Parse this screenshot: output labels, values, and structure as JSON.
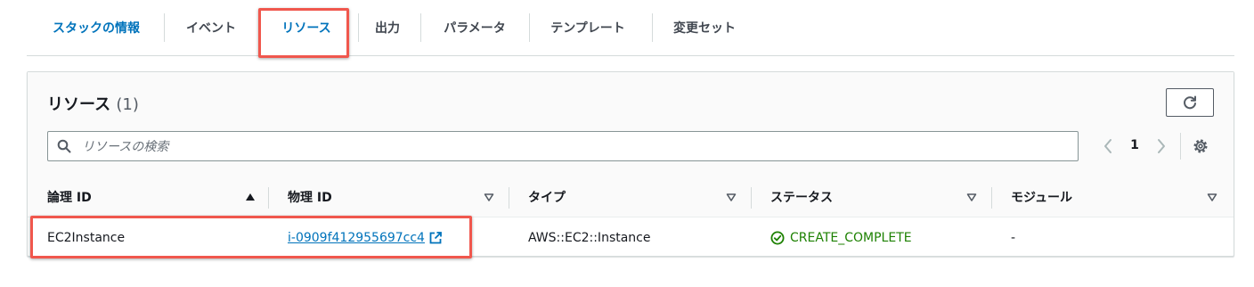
{
  "tabs": [
    {
      "label": "スタックの情報",
      "active": true
    },
    {
      "label": "イベント",
      "active": false
    },
    {
      "label": "リソース",
      "active": false
    },
    {
      "label": "出力",
      "active": false
    },
    {
      "label": "パラメータ",
      "active": false
    },
    {
      "label": "テンプレート",
      "active": false
    },
    {
      "label": "変更セット",
      "active": false
    }
  ],
  "panel": {
    "title": "リソース",
    "count": "(1)",
    "refresh_icon": "refresh-icon",
    "search_placeholder": "リソースの検索",
    "search_value": "",
    "page_number": "1",
    "settings_icon": "gear-icon"
  },
  "table": {
    "columns": [
      "論理 ID",
      "物理 ID",
      "タイプ",
      "ステータス",
      "モジュール"
    ],
    "sort": {
      "column": "論理 ID",
      "direction": "ascending"
    },
    "rows": [
      {
        "logical_id": "EC2Instance",
        "physical_id": "i-0909f412955697cc4",
        "type": "AWS::EC2::Instance",
        "status": "CREATE_COMPLETE",
        "module": "-"
      }
    ]
  },
  "colors": {
    "accent": "#0073bb",
    "success": "#1d8102",
    "highlight": "#f0574d"
  }
}
